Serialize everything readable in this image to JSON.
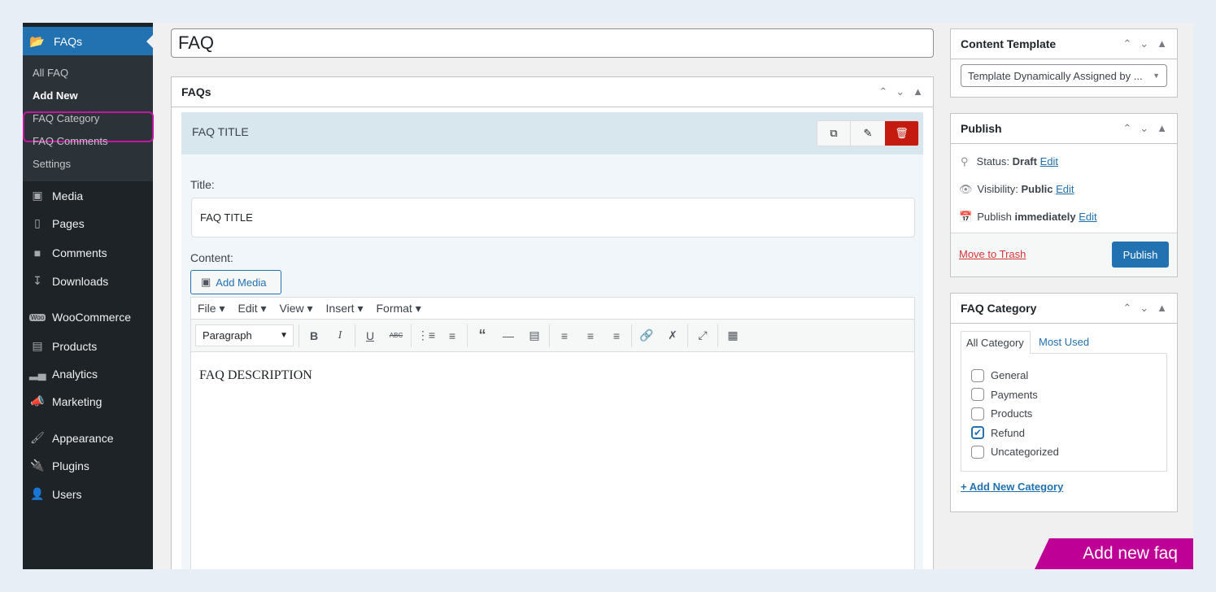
{
  "sidebar": {
    "menu_title": "FAQs",
    "submenu": [
      "All FAQ",
      "Add New",
      "FAQ Category",
      "FAQ Comments",
      "Settings"
    ],
    "items": [
      {
        "label": "Media",
        "icon": "media-icon"
      },
      {
        "label": "Pages",
        "icon": "pages-icon"
      },
      {
        "label": "Comments",
        "icon": "comments-icon"
      },
      {
        "label": "Downloads",
        "icon": "downloads-icon"
      },
      {
        "label": "WooCommerce",
        "icon": "woocommerce-icon"
      },
      {
        "label": "Products",
        "icon": "products-icon"
      },
      {
        "label": "Analytics",
        "icon": "analytics-icon"
      },
      {
        "label": "Marketing",
        "icon": "marketing-icon"
      },
      {
        "label": "Appearance",
        "icon": "appearance-icon"
      },
      {
        "label": "Plugins",
        "icon": "plugins-icon"
      },
      {
        "label": "Users",
        "icon": "users-icon"
      }
    ]
  },
  "post_title": "FAQ",
  "faq_box": {
    "title": "FAQs",
    "item_title": "FAQ TITLE",
    "title_label": "Title:",
    "title_value": "FAQ TITLE",
    "content_label": "Content:",
    "add_media": "Add Media",
    "menu": [
      "File",
      "Edit",
      "View",
      "Insert",
      "Format"
    ],
    "format_select": "Paragraph",
    "content": "FAQ DESCRIPTION"
  },
  "content_template": {
    "title": "Content Template",
    "select": "Template Dynamically Assigned by ..."
  },
  "publish": {
    "title": "Publish",
    "status_label": "Status:",
    "status": "Draft",
    "visibility_label": "Visibility:",
    "visibility": "Public",
    "schedule_label": "Publish",
    "schedule": "immediately",
    "edit": "Edit",
    "trash": "Move to Trash",
    "button": "Publish"
  },
  "faq_category": {
    "title": "FAQ Category",
    "tabs": [
      "All Category",
      "Most Used"
    ],
    "categories": [
      {
        "label": "General",
        "checked": false
      },
      {
        "label": "Payments",
        "checked": false
      },
      {
        "label": "Products",
        "checked": false
      },
      {
        "label": "Refund",
        "checked": true
      },
      {
        "label": "Uncategorized",
        "checked": false
      }
    ],
    "add_new": "+ Add New Category"
  },
  "banner": "Add new faq",
  "colors": {
    "accent": "#2271b1",
    "highlight": "#c3169f",
    "banner": "#bf0096",
    "delete": "#c51a10"
  }
}
